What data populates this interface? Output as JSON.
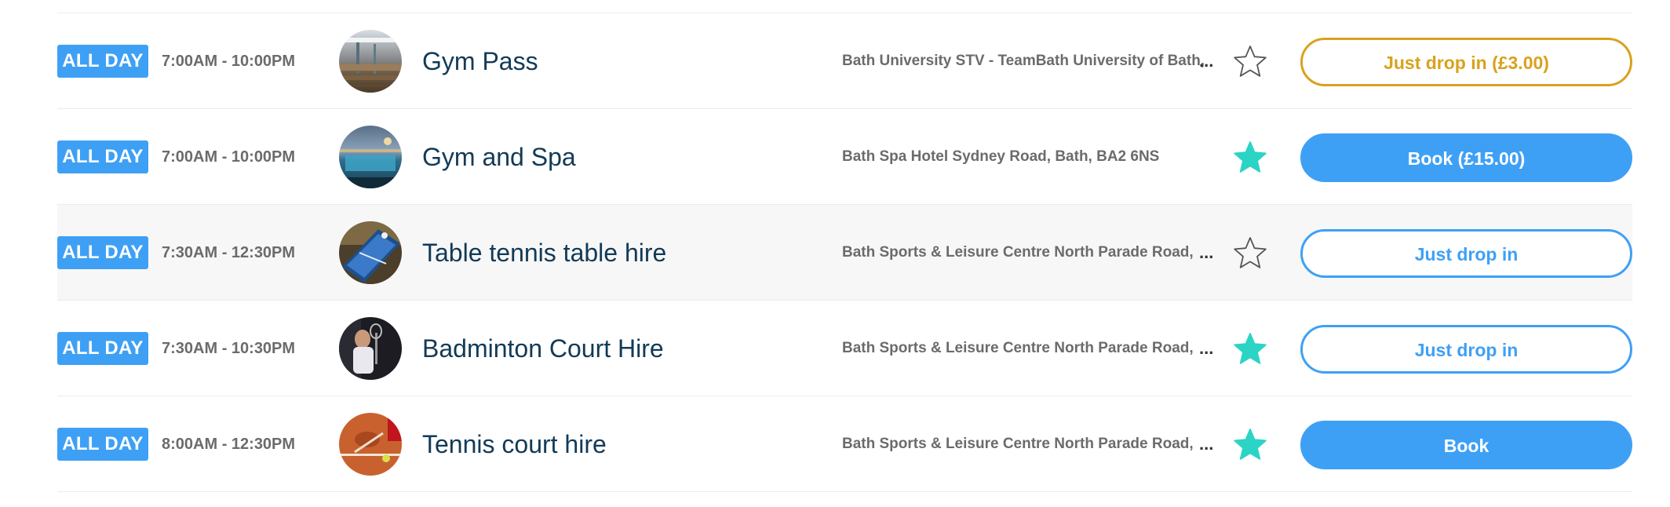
{
  "colors": {
    "badge": "#3ea0f5",
    "title": "#123a57",
    "muted": "#6b6b6b",
    "favorite": "#2bd4c5",
    "gold": "#d9a21c",
    "blue": "#3ea0f5"
  },
  "sessions": [
    {
      "badge": "ALL DAY",
      "time": "7:00AM - 10:00PM",
      "title": "Gym Pass",
      "venue": "Bath University STV - TeamBath University of Bath,",
      "favorite": false,
      "thumb_icon": "gym-pool-photo",
      "action": "Just drop in (£3.00)",
      "action_style": "outline-gold"
    },
    {
      "badge": "ALL DAY",
      "time": "7:00AM - 10:00PM",
      "title": "Gym and Spa",
      "venue": "Bath Spa Hotel Sydney Road, Bath, BA2 6NS",
      "favorite": true,
      "thumb_icon": "spa-pool-photo",
      "action": "Book (£15.00)",
      "action_style": "filled-blue"
    },
    {
      "badge": "ALL DAY",
      "time": "7:30AM - 12:30PM",
      "title": "Table tennis table hire",
      "venue": "Bath Sports & Leisure Centre North Parade Road,",
      "favorite": false,
      "thumb_icon": "table-tennis-photo",
      "action": "Just drop in",
      "action_style": "outline-blue"
    },
    {
      "badge": "ALL DAY",
      "time": "7:30AM - 10:30PM",
      "title": "Badminton Court Hire",
      "venue": "Bath Sports & Leisure Centre North Parade Road,",
      "favorite": true,
      "thumb_icon": "badminton-photo",
      "action": "Just drop in",
      "action_style": "outline-blue"
    },
    {
      "badge": "ALL DAY",
      "time": "8:00AM - 12:30PM",
      "title": "Tennis court hire",
      "venue": "Bath Sports & Leisure Centre North Parade Road,",
      "favorite": true,
      "thumb_icon": "tennis-court-photo",
      "action": "Book",
      "action_style": "filled-blue"
    }
  ],
  "ellipsis": "..."
}
